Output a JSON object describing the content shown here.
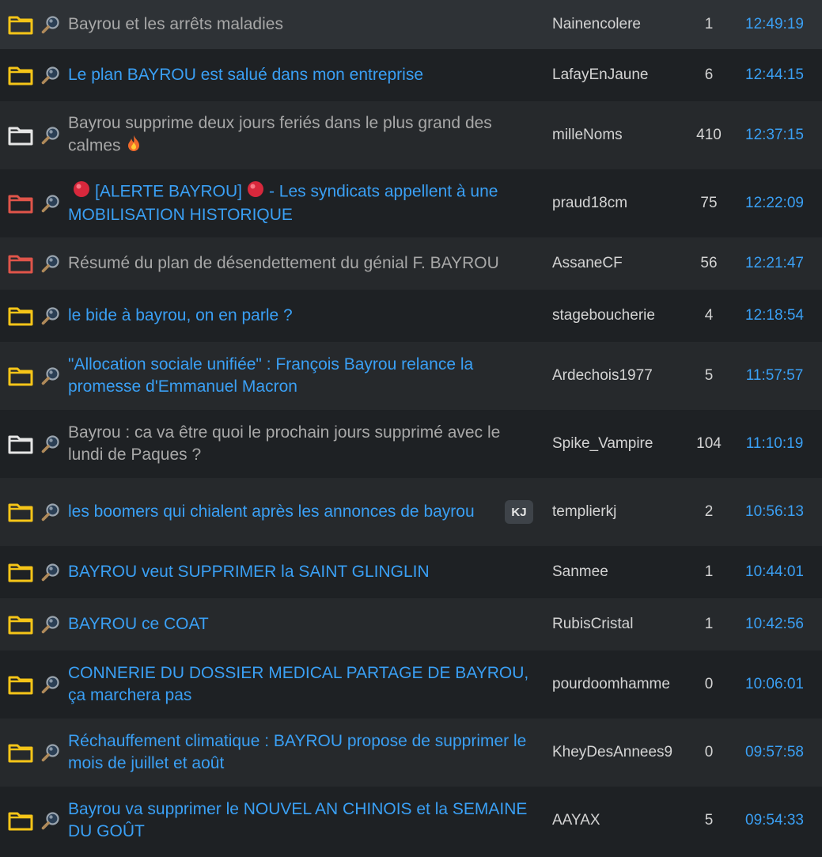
{
  "colors": {
    "folder_yellow": "#f5c518",
    "folder_white": "#e6e6e6",
    "folder_red": "#e0554a",
    "link_blue": "#3aa0f5",
    "visited_grey": "#a8a8a8"
  },
  "topics": [
    {
      "title_parts": [
        {
          "text": "Bayrou et les arrêts maladies"
        }
      ],
      "author": "Nainencolere",
      "count": "1",
      "time": "12:49:19",
      "folder": "yellow",
      "style": "read",
      "badge": null
    },
    {
      "title_parts": [
        {
          "text": "Le plan BAYROU est salué dans mon entreprise"
        }
      ],
      "author": "LafayEnJaune",
      "count": "6",
      "time": "12:44:15",
      "folder": "yellow",
      "style": "new",
      "badge": null
    },
    {
      "title_parts": [
        {
          "text": "Bayrou supprime deux jours feriés dans le plus grand des calmes"
        },
        {
          "emoji": "fire"
        }
      ],
      "author": "milleNoms",
      "count": "410",
      "time": "12:37:15",
      "folder": "white",
      "style": "read",
      "badge": null
    },
    {
      "title_parts": [
        {
          "emoji": "red-circle"
        },
        {
          "text": "[ALERTE BAYROU]"
        },
        {
          "emoji": "red-circle"
        },
        {
          "text": "- Les syndicats appellent à une MOBILISATION HISTORIQUE"
        }
      ],
      "author": "praud18cm",
      "count": "75",
      "time": "12:22:09",
      "folder": "red",
      "style": "new",
      "badge": null
    },
    {
      "title_parts": [
        {
          "text": "Résumé du plan de désendettement du génial F. BAYROU"
        }
      ],
      "author": "AssaneCF",
      "count": "56",
      "time": "12:21:47",
      "folder": "red",
      "style": "read",
      "badge": null
    },
    {
      "title_parts": [
        {
          "text": "le bide à bayrou, on en parle ?"
        }
      ],
      "author": "stageboucherie",
      "count": "4",
      "time": "12:18:54",
      "folder": "yellow",
      "style": "new",
      "badge": null
    },
    {
      "title_parts": [
        {
          "text": "\"Allocation sociale unifiée\" : François Bayrou relance la promesse d'Emmanuel Macron"
        }
      ],
      "author": "Ardechois1977",
      "count": "5",
      "time": "11:57:57",
      "folder": "yellow",
      "style": "new",
      "badge": null
    },
    {
      "title_parts": [
        {
          "text": "Bayrou : ca va être quoi le prochain jours supprimé avec le lundi de Paques ?"
        }
      ],
      "author": "Spike_Vampire",
      "count": "104",
      "time": "11:10:19",
      "folder": "white",
      "style": "read",
      "badge": null
    },
    {
      "title_parts": [
        {
          "text": "les boomers qui chialent après les annonces de bayrou"
        }
      ],
      "author": "templierkj",
      "count": "2",
      "time": "10:56:13",
      "folder": "yellow",
      "style": "new",
      "badge": "KJ"
    },
    {
      "title_parts": [
        {
          "text": "BAYROU veut SUPPRIMER la SAINT GLINGLIN"
        }
      ],
      "author": "Sanmee",
      "count": "1",
      "time": "10:44:01",
      "folder": "yellow",
      "style": "new",
      "badge": null
    },
    {
      "title_parts": [
        {
          "text": "BAYROU ce COAT"
        }
      ],
      "author": "RubisCristal",
      "count": "1",
      "time": "10:42:56",
      "folder": "yellow",
      "style": "new",
      "badge": null
    },
    {
      "title_parts": [
        {
          "text": "CONNERIE DU DOSSIER MEDICAL PARTAGE DE BAYROU, ça marchera pas"
        }
      ],
      "author": "pourdoomhamme",
      "count": "0",
      "time": "10:06:01",
      "folder": "yellow",
      "style": "new",
      "badge": null
    },
    {
      "title_parts": [
        {
          "text": "Réchauffement climatique : BAYROU propose de supprimer le mois de juillet et août"
        }
      ],
      "author": "KheyDesAnnees9",
      "count": "0",
      "time": "09:57:58",
      "folder": "yellow",
      "style": "new",
      "badge": null
    },
    {
      "title_parts": [
        {
          "text": "Bayrou va supprimer le NOUVEL AN CHINOIS et la SEMAINE DU GOÛT"
        }
      ],
      "author": "AAYAX",
      "count": "5",
      "time": "09:54:33",
      "folder": "yellow",
      "style": "new",
      "badge": null
    }
  ]
}
